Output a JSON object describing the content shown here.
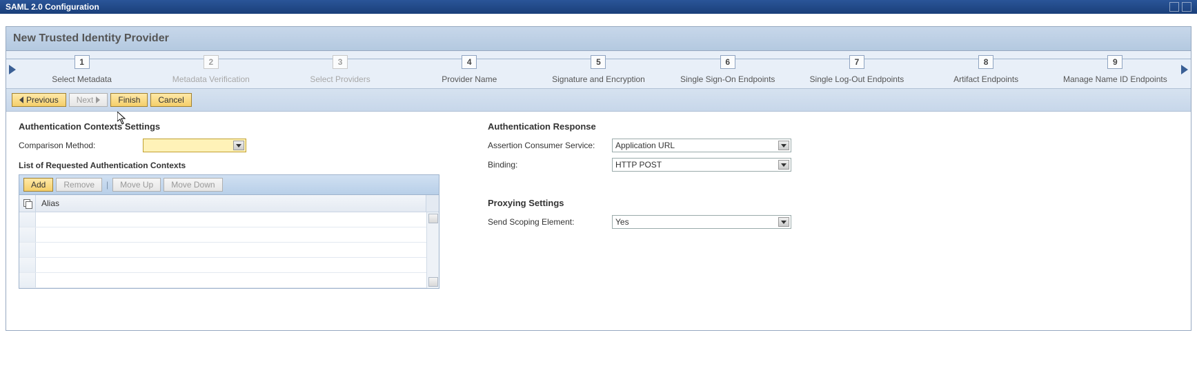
{
  "titlebar": {
    "title": "SAML 2.0 Configuration"
  },
  "wizard": {
    "heading": "New Trusted Identity Provider",
    "steps": [
      {
        "num": "1",
        "label": "Select Metadata",
        "state": "done"
      },
      {
        "num": "2",
        "label": "Metadata Verification",
        "state": "dim"
      },
      {
        "num": "3",
        "label": "Select Providers",
        "state": "dim"
      },
      {
        "num": "4",
        "label": "Provider Name",
        "state": "done"
      },
      {
        "num": "5",
        "label": "Signature and Encryption",
        "state": "done"
      },
      {
        "num": "6",
        "label": "Single Sign-On Endpoints",
        "state": "done"
      },
      {
        "num": "7",
        "label": "Single Log-Out Endpoints",
        "state": "done"
      },
      {
        "num": "8",
        "label": "Artifact Endpoints",
        "state": "done"
      },
      {
        "num": "9",
        "label": "Manage Name ID Endpoints",
        "state": "done"
      }
    ]
  },
  "nav": {
    "previous": "Previous",
    "next": "Next",
    "finish": "Finish",
    "cancel": "Cancel"
  },
  "left": {
    "section_title": "Authentication Contexts Settings",
    "comparison_label": "Comparison Method:",
    "comparison_value": "",
    "list_title": "List of Requested Authentication Contexts",
    "toolbar": {
      "add": "Add",
      "remove": "Remove",
      "moveup": "Move Up",
      "movedown": "Move Down"
    },
    "table": {
      "col_alias": "Alias",
      "rows": [
        "",
        "",
        "",
        "",
        ""
      ]
    }
  },
  "right": {
    "section_title": "Authentication Response",
    "acs_label": "Assertion Consumer Service:",
    "acs_value": "Application URL",
    "binding_label": "Binding:",
    "binding_value": "HTTP POST",
    "proxy_title": "Proxying Settings",
    "scoping_label": "Send Scoping Element:",
    "scoping_value": "Yes"
  }
}
